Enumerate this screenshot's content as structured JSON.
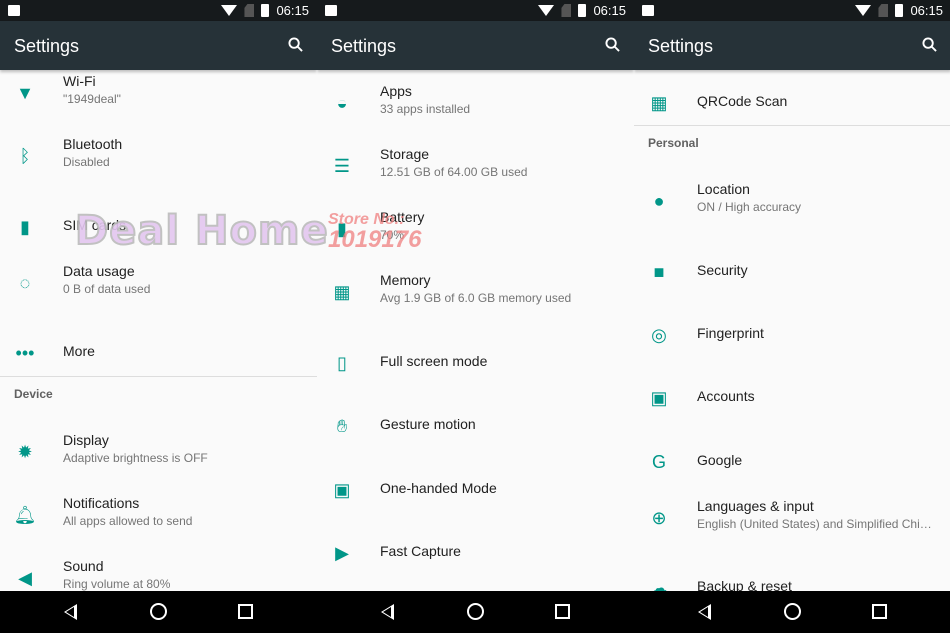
{
  "status_bar": {
    "time": "06:15"
  },
  "toolbar": {
    "title": "Settings"
  },
  "colors": {
    "accent": "#009688",
    "toolbar": "#263238"
  },
  "panel1": {
    "items": [
      {
        "title": "Wi-Fi",
        "subtitle": "\"1949deal\"",
        "icon": "wifi-icon"
      },
      {
        "title": "Bluetooth",
        "subtitle": "Disabled",
        "icon": "bluetooth-icon"
      },
      {
        "title": "SIM cards",
        "icon": "sim-card-icon"
      },
      {
        "title": "Data usage",
        "subtitle": "0 B of data used",
        "icon": "data-usage-icon"
      },
      {
        "title": "More",
        "icon": "more-icon"
      }
    ],
    "section": "Device",
    "device_items": [
      {
        "title": "Display",
        "subtitle": "Adaptive brightness is OFF",
        "icon": "brightness-icon"
      },
      {
        "title": "Notifications",
        "subtitle": "All apps allowed to send",
        "icon": "bell-icon"
      },
      {
        "title": "Sound",
        "subtitle": "Ring volume at 80%",
        "icon": "volume-icon"
      }
    ]
  },
  "panel2": {
    "items": [
      {
        "title": "Apps",
        "subtitle": "33 apps installed",
        "icon": "android-icon"
      },
      {
        "title": "Storage",
        "subtitle": "12.51 GB of 64.00 GB used",
        "icon": "storage-icon"
      },
      {
        "title": "Battery",
        "subtitle": "70%",
        "icon": "battery-icon"
      },
      {
        "title": "Memory",
        "subtitle": "Avg 1.9 GB of 6.0 GB memory used",
        "icon": "memory-icon"
      },
      {
        "title": "Full screen mode",
        "icon": "fullscreen-icon"
      },
      {
        "title": "Gesture motion",
        "icon": "gesture-icon"
      },
      {
        "title": "One-handed Mode",
        "icon": "one-handed-icon"
      },
      {
        "title": "Fast Capture",
        "icon": "camera-icon"
      }
    ]
  },
  "panel3": {
    "top_item": {
      "title": "QRCode Scan",
      "icon": "qrcode-icon"
    },
    "section": "Personal",
    "items": [
      {
        "title": "Location",
        "subtitle": "ON / High accuracy",
        "icon": "location-icon"
      },
      {
        "title": "Security",
        "icon": "lock-icon"
      },
      {
        "title": "Fingerprint",
        "icon": "fingerprint-icon"
      },
      {
        "title": "Accounts",
        "icon": "account-icon"
      },
      {
        "title": "Google",
        "icon": "google-icon"
      },
      {
        "title": "Languages & input",
        "subtitle": "English (United States) and Simplified Chi…",
        "icon": "globe-icon"
      },
      {
        "title": "Backup & reset",
        "icon": "cloud-upload-icon"
      }
    ]
  },
  "watermark": {
    "brand": "Deal Home",
    "store_label": "Store No.:",
    "store_number": "1019176"
  }
}
